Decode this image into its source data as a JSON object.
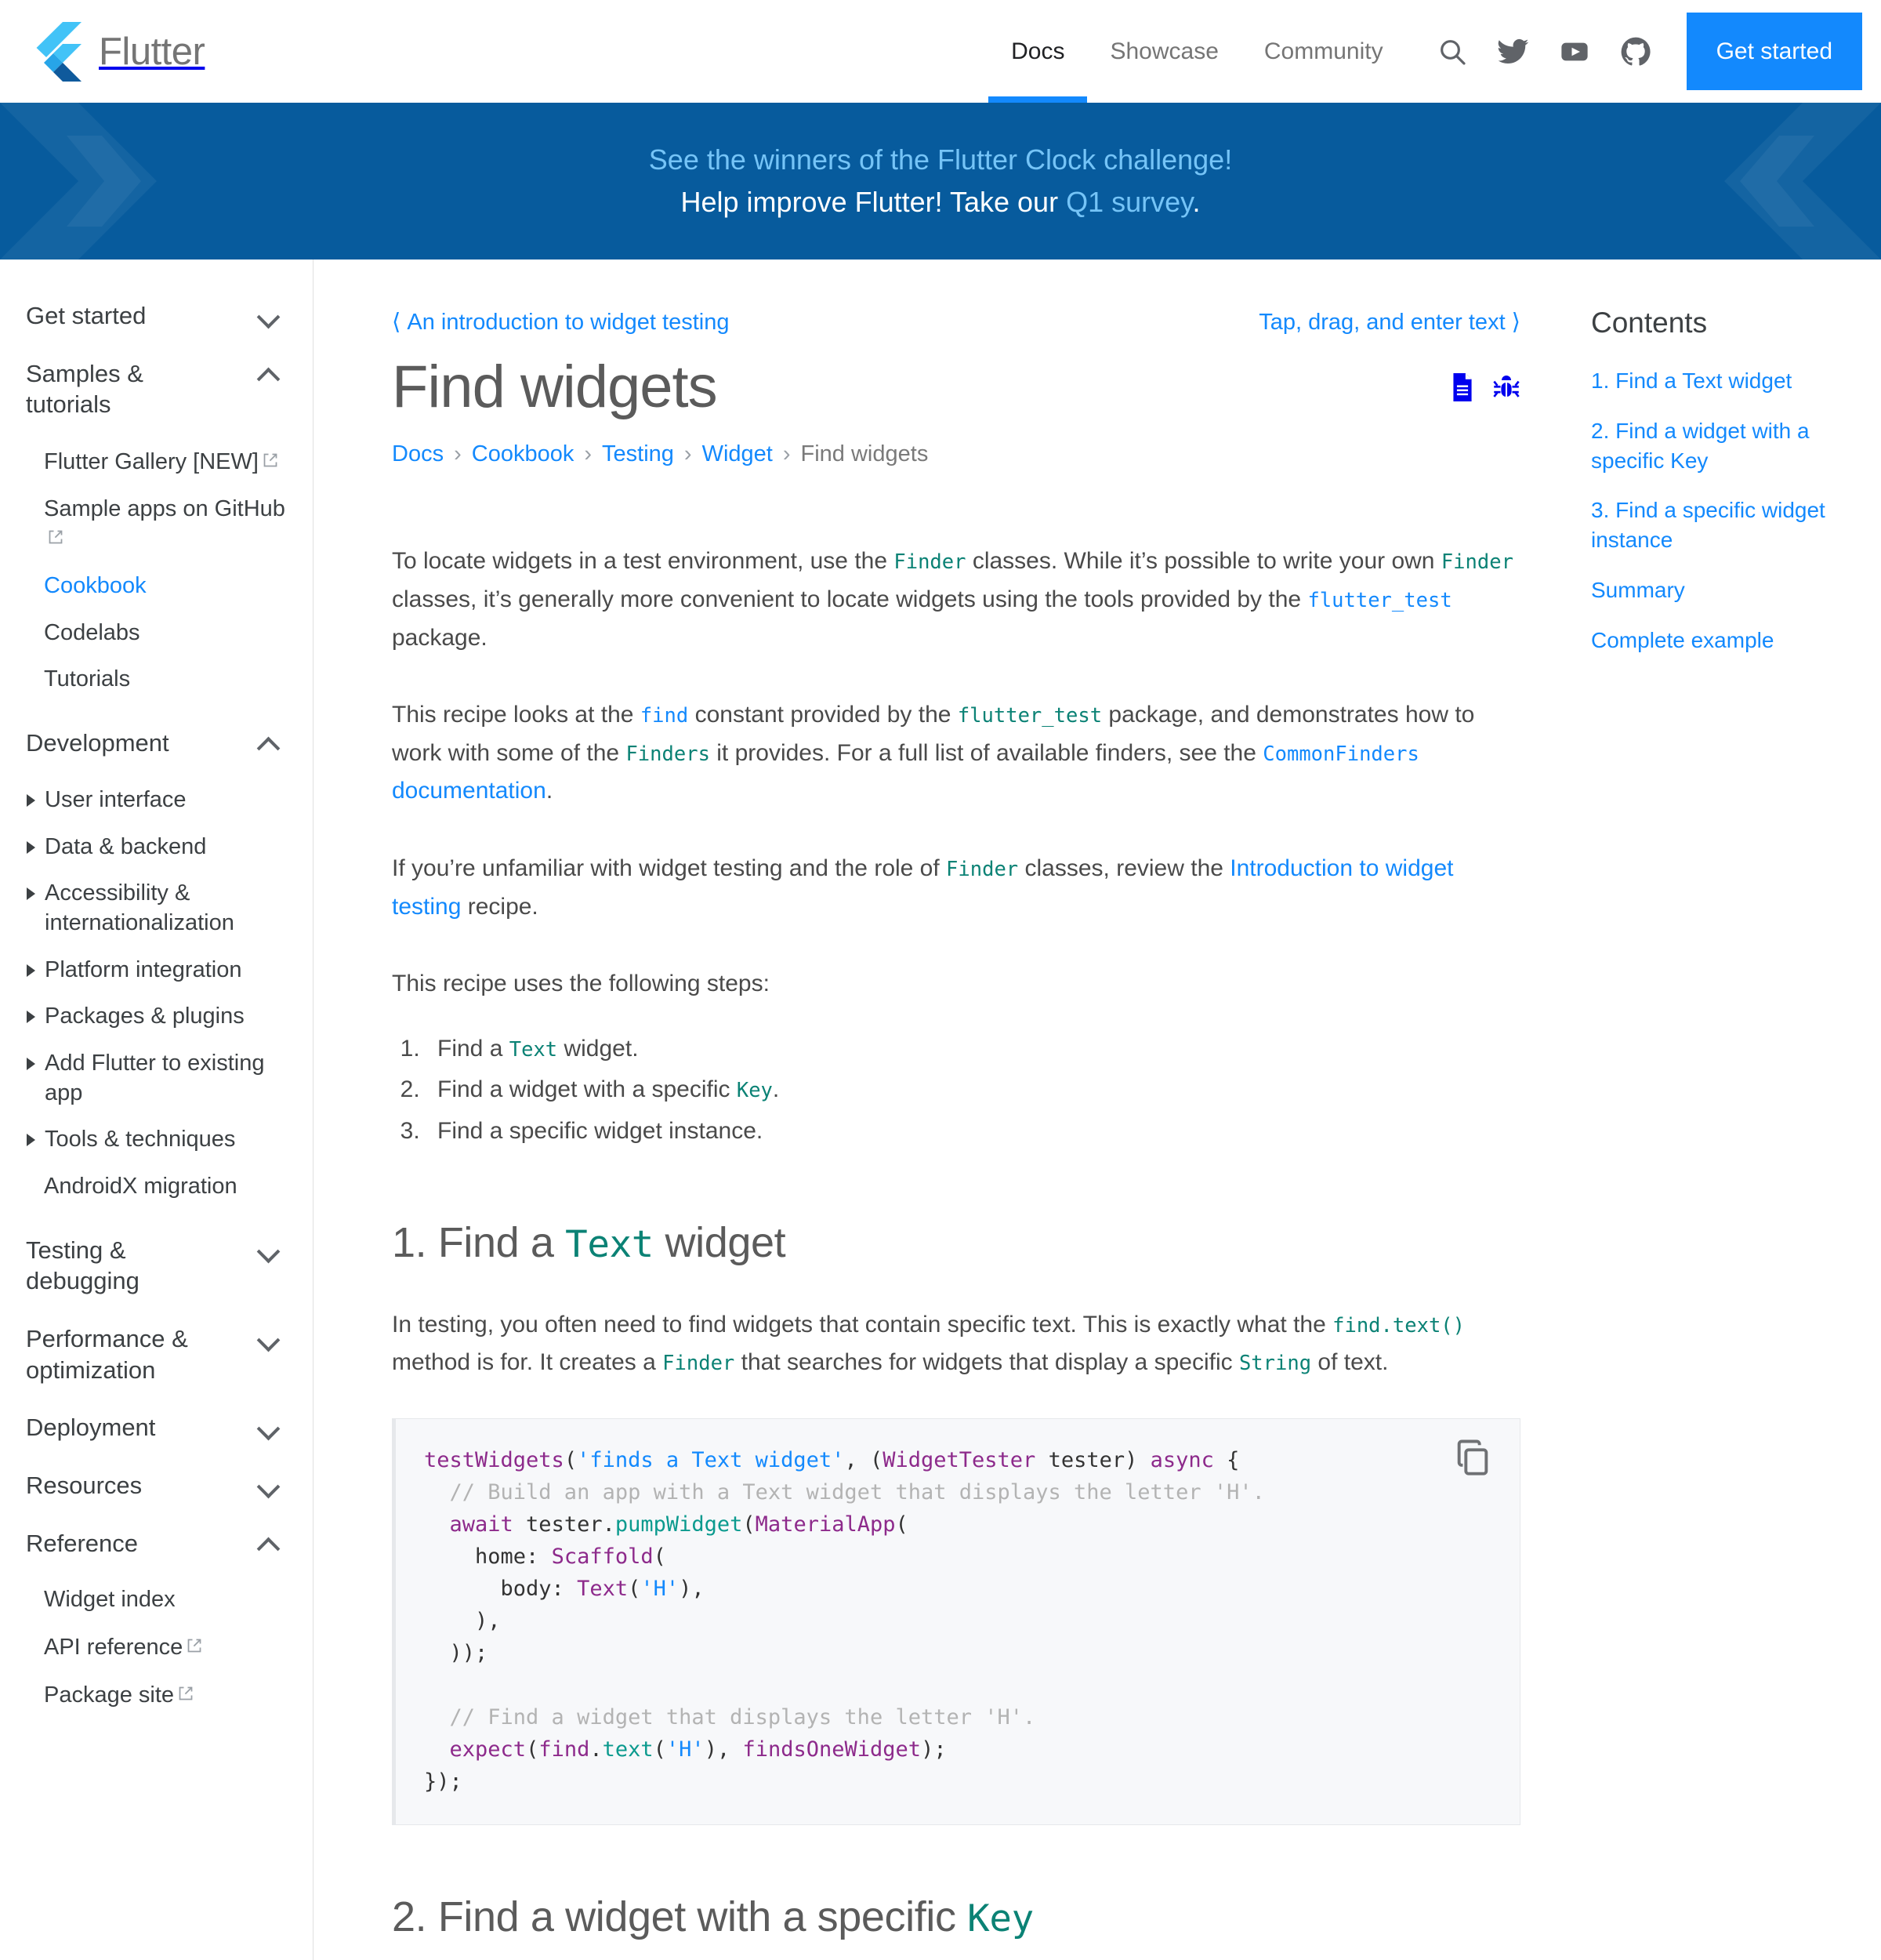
{
  "nav": {
    "brand": "Flutter",
    "links": [
      {
        "label": "Docs",
        "active": true
      },
      {
        "label": "Showcase",
        "active": false
      },
      {
        "label": "Community",
        "active": false
      }
    ],
    "icons": [
      "search-icon",
      "twitter-icon",
      "youtube-icon",
      "github-icon"
    ],
    "cta": "Get started"
  },
  "banner": {
    "line1": "See the winners of the Flutter Clock challenge!",
    "line2_prefix": "Help improve Flutter! Take our ",
    "line2_link": "Q1 survey",
    "line2_suffix": ".",
    "bg_color": "#075b9d",
    "link_color": "#75c4f7"
  },
  "sidebar": {
    "groups": [
      {
        "label": "Get started",
        "state": "collapsed",
        "items": []
      },
      {
        "label": "Samples & tutorials",
        "state": "expanded",
        "items": [
          {
            "label": "Flutter Gallery [NEW]",
            "external": true,
            "active": false
          },
          {
            "label": "Sample apps on GitHub",
            "external": true,
            "active": false
          },
          {
            "label": "Cookbook",
            "external": false,
            "active": true
          },
          {
            "label": "Codelabs",
            "external": false,
            "active": false
          },
          {
            "label": "Tutorials",
            "external": false,
            "active": false
          }
        ]
      },
      {
        "label": "Development",
        "state": "expanded",
        "subitems": [
          {
            "label": "User interface",
            "arrow": true
          },
          {
            "label": "Data & backend",
            "arrow": true
          },
          {
            "label": "Accessibility & internationalization",
            "arrow": true
          },
          {
            "label": "Platform integration",
            "arrow": true
          },
          {
            "label": "Packages & plugins",
            "arrow": true
          },
          {
            "label": "Add Flutter to existing app",
            "arrow": true
          },
          {
            "label": "Tools & techniques",
            "arrow": true
          },
          {
            "label": "AndroidX migration",
            "arrow": false
          }
        ]
      },
      {
        "label": "Testing & debugging",
        "state": "collapsed",
        "items": []
      },
      {
        "label": "Performance & optimization",
        "state": "collapsed",
        "items": []
      },
      {
        "label": "Deployment",
        "state": "collapsed",
        "items": []
      },
      {
        "label": "Resources",
        "state": "collapsed",
        "items": []
      },
      {
        "label": "Reference",
        "state": "expanded",
        "items": [
          {
            "label": "Widget index",
            "external": false,
            "active": false
          },
          {
            "label": "API reference",
            "external": true,
            "active": false
          },
          {
            "label": "Package site",
            "external": true,
            "active": false
          }
        ]
      }
    ]
  },
  "main": {
    "prev_link": "An introduction to widget testing",
    "next_link": "Tap, drag, and enter text",
    "title": "Find widgets",
    "title_icons": [
      "document-icon",
      "bug-icon"
    ],
    "breadcrumb": [
      {
        "label": "Docs",
        "link": true
      },
      {
        "label": "Cookbook",
        "link": true
      },
      {
        "label": "Testing",
        "link": true
      },
      {
        "label": "Widget",
        "link": true
      },
      {
        "label": "Find widgets",
        "link": false
      }
    ],
    "p1": {
      "a": "To locate widgets in a test environment, use the ",
      "c1": "Finder",
      "b": " classes. While it’s possible to write your own ",
      "c2": "Finder",
      "c": " classes, it’s generally more convenient to locate widgets using the tools provided by the ",
      "c3": "flutter_test",
      "d": " package."
    },
    "p2": {
      "a": "This recipe looks at the ",
      "c1": "find",
      "b": " constant provided by the ",
      "c2": "flutter_test",
      "c": " package, and demonstrates how to work with some of the ",
      "c3": "Finders",
      "d": " it provides. For a full list of available finders, see the ",
      "link_code": "CommonFinders",
      "link_text": " documentation",
      "e": "."
    },
    "p3": {
      "a": "If you’re unfamiliar with widget testing and the role of ",
      "c1": "Finder",
      "b": " classes, review the ",
      "link": "Introduction to widget testing",
      "c": " recipe."
    },
    "p4": "This recipe uses the following steps:",
    "steps": [
      {
        "a": "Find a ",
        "code": "Text",
        "b": " widget."
      },
      {
        "a": "Find a widget with a specific ",
        "code": "Key",
        "b": "."
      },
      {
        "a": "Find a specific widget instance.",
        "code": "",
        "b": ""
      }
    ],
    "section1": {
      "a": "1. Find a ",
      "code": "Text",
      "b": " widget"
    },
    "p5": {
      "a": "In testing, you often need to find widgets that contain specific text. This is exactly what the ",
      "c1": "find.text()",
      "b": " method is for. It creates a ",
      "c2": "Finder",
      "c": " that searches for widgets that display a specific ",
      "c3": "String",
      "d": " of text."
    },
    "code_copy_label": "copy-icon",
    "code_lines": [
      [
        {
          "t": "testWidgets",
          "c": "kw"
        },
        {
          "t": "(",
          "c": "pl"
        },
        {
          "t": "'finds a Text widget'",
          "c": "str"
        },
        {
          "t": ", (",
          "c": "pl"
        },
        {
          "t": "WidgetTester",
          "c": "kw"
        },
        {
          "t": " tester) ",
          "c": "pl"
        },
        {
          "t": "async",
          "c": "kw"
        },
        {
          "t": " {",
          "c": "pl"
        }
      ],
      [
        {
          "t": "  // Build an app with a Text widget that displays the letter 'H'.",
          "c": "com"
        }
      ],
      [
        {
          "t": "  ",
          "c": "pl"
        },
        {
          "t": "await",
          "c": "kw"
        },
        {
          "t": " tester.",
          "c": "pl"
        },
        {
          "t": "pumpWidget",
          "c": "fn"
        },
        {
          "t": "(",
          "c": "pl"
        },
        {
          "t": "MaterialApp",
          "c": "kw"
        },
        {
          "t": "(",
          "c": "pl"
        }
      ],
      [
        {
          "t": "    home: ",
          "c": "pl"
        },
        {
          "t": "Scaffold",
          "c": "kw"
        },
        {
          "t": "(",
          "c": "pl"
        }
      ],
      [
        {
          "t": "      body: ",
          "c": "pl"
        },
        {
          "t": "Text",
          "c": "kw"
        },
        {
          "t": "(",
          "c": "pl"
        },
        {
          "t": "'H'",
          "c": "str"
        },
        {
          "t": "),",
          "c": "pl"
        }
      ],
      [
        {
          "t": "    ),",
          "c": "pl"
        }
      ],
      [
        {
          "t": "  ));",
          "c": "pl"
        }
      ],
      [
        {
          "t": "",
          "c": "pl"
        }
      ],
      [
        {
          "t": "  // Find a widget that displays the letter 'H'.",
          "c": "com"
        }
      ],
      [
        {
          "t": "  ",
          "c": "pl"
        },
        {
          "t": "expect",
          "c": "kw"
        },
        {
          "t": "(",
          "c": "pl"
        },
        {
          "t": "find",
          "c": "kw"
        },
        {
          "t": ".",
          "c": "pl"
        },
        {
          "t": "text",
          "c": "fn"
        },
        {
          "t": "(",
          "c": "pl"
        },
        {
          "t": "'H'",
          "c": "str"
        },
        {
          "t": "), ",
          "c": "pl"
        },
        {
          "t": "findsOneWidget",
          "c": "kw"
        },
        {
          "t": ");",
          "c": "pl"
        }
      ],
      [
        {
          "t": "});",
          "c": "pl"
        }
      ]
    ],
    "section2": {
      "a": "2. Find a widget with a specific ",
      "code": "Key",
      "b": ""
    }
  },
  "toc": {
    "title": "Contents",
    "items": [
      "1. Find a Text widget",
      "2. Find a widget with a specific Key",
      "3. Find a specific widget instance",
      "Summary",
      "Complete example"
    ]
  },
  "colors": {
    "accent_blue": "#1389fd",
    "banner_blue": "#075b9d",
    "code_teal": "#0b8275",
    "code_purple": "#8d2a8b"
  }
}
